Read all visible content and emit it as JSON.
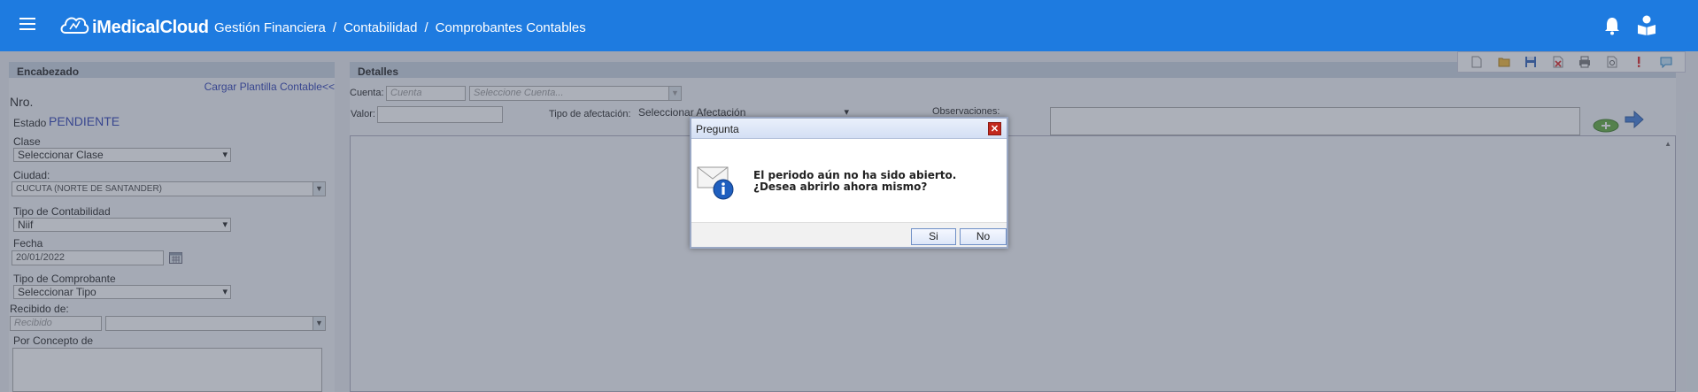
{
  "header": {
    "brand": "iMedicalCloud",
    "breadcrumb": [
      "Gestión Financiera",
      "/",
      "Contabilidad",
      "/",
      "Comprobantes Contables"
    ]
  },
  "left": {
    "panel_title": "Encabezado",
    "template_link": "Cargar Plantilla Contable<<",
    "nro_label": "Nro.",
    "estado_label": "Estado",
    "estado_value": "PENDIENTE",
    "clase_label": "Clase",
    "clase_value": "Seleccionar Clase",
    "ciudad_label": "Ciudad:",
    "ciudad_value": "CUCUTA (NORTE DE SANTANDER)",
    "tipo_contab_label": "Tipo de Contabilidad",
    "tipo_contab_value": "Niif",
    "fecha_label": "Fecha",
    "fecha_value": "20/01/2022",
    "tipo_comp_label": "Tipo de Comprobante",
    "tipo_comp_value": "Seleccionar Tipo",
    "recibido_label": "Recibido de:",
    "recibido_placeholder": "Recibido",
    "concepto_label": "Por Concepto de"
  },
  "right": {
    "panel_title": "Detalles",
    "cuenta_label": "Cuenta:",
    "cuenta_placeholder": "Cuenta",
    "cuenta_select_placeholder": "Seleccione Cuenta...",
    "valor_label": "Valor:",
    "afectacion_label": "Tipo de afectación:",
    "afectacion_value": "Seleccionar Afectación",
    "observaciones_label": "Observaciones:"
  },
  "dialog": {
    "title": "Pregunta",
    "message": "El periodo aún no ha sido abierto. ¿Desea abrirlo ahora mismo?",
    "yes_label": "Si",
    "no_label": "No"
  },
  "colors": {
    "topbar": "#1e7be0",
    "estado_value": "#2b3db2",
    "close_button": "#c2281d"
  },
  "icons": {
    "menu": "hamburger-icon",
    "logo": "cloud-logo-icon",
    "notifications": "bell-icon",
    "profile": "user-book-icon",
    "toolbar": [
      "new-document-icon",
      "open-folder-icon",
      "save-icon",
      "delete-icon",
      "print-icon",
      "preview-icon",
      "alert-icon",
      "comment-icon"
    ],
    "dialog": "info-icon"
  }
}
